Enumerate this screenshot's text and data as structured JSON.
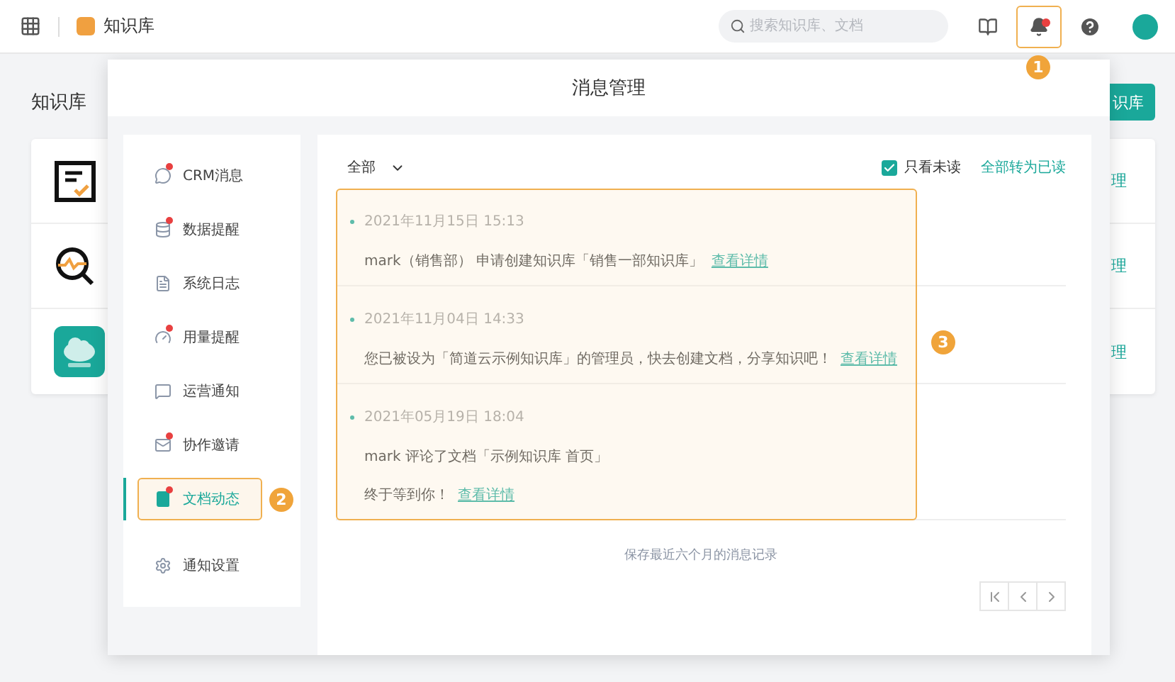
{
  "topbar": {
    "app_name": "知识库",
    "search": {
      "placeholder": "搜索知识库、文档"
    },
    "unread_alert": true,
    "callout": "1"
  },
  "page": {
    "title": "知识库",
    "button": "识库",
    "cards": [
      {
        "kind": "form",
        "action": "理"
      },
      {
        "kind": "search",
        "action": "理"
      },
      {
        "kind": "cloud",
        "action": "理"
      }
    ]
  },
  "modal": {
    "title": "消息管理",
    "nav": [
      {
        "kind": "crm",
        "label": "CRM消息",
        "unread": true,
        "selected": false
      },
      {
        "kind": "data",
        "label": "数据提醒",
        "unread": true,
        "selected": false
      },
      {
        "kind": "log",
        "label": "系统日志",
        "unread": false,
        "selected": false
      },
      {
        "kind": "usage",
        "label": "用量提醒",
        "unread": true,
        "selected": false
      },
      {
        "kind": "notice",
        "label": "运营通知",
        "unread": false,
        "selected": false
      },
      {
        "kind": "invite",
        "label": "协作邀请",
        "unread": true,
        "selected": false
      },
      {
        "kind": "doc",
        "label": "文档动态",
        "unread": true,
        "selected": true
      },
      {
        "kind": "settings",
        "label": "通知设置",
        "unread": false,
        "selected": false
      }
    ],
    "nav_callout": "2",
    "filter": "全部",
    "unread_only": {
      "label": "只看未读",
      "checked": true
    },
    "mark_all": "全部转为已读",
    "messages": [
      {
        "time": "2021年11月15日 15:13",
        "lines": [
          {
            "text": "mark（销售部） 申请创建知识库「销售一部知识库」",
            "link": "查看详情"
          }
        ]
      },
      {
        "time": "2021年11月04日 14:33",
        "lines": [
          {
            "text": "您已被设为「简道云示例知识库」的管理员，快去创建文档，分享知识吧！",
            "link": "查看详情"
          }
        ]
      },
      {
        "time": "2021年05月19日 18:04",
        "lines": [
          {
            "text": "mark 评论了文档「示例知识库 首页」"
          },
          {
            "text": "终于等到你！",
            "link": "查看详情"
          }
        ]
      }
    ],
    "messages_callout": "3",
    "footer": "保存最近六个月的消息记录"
  }
}
